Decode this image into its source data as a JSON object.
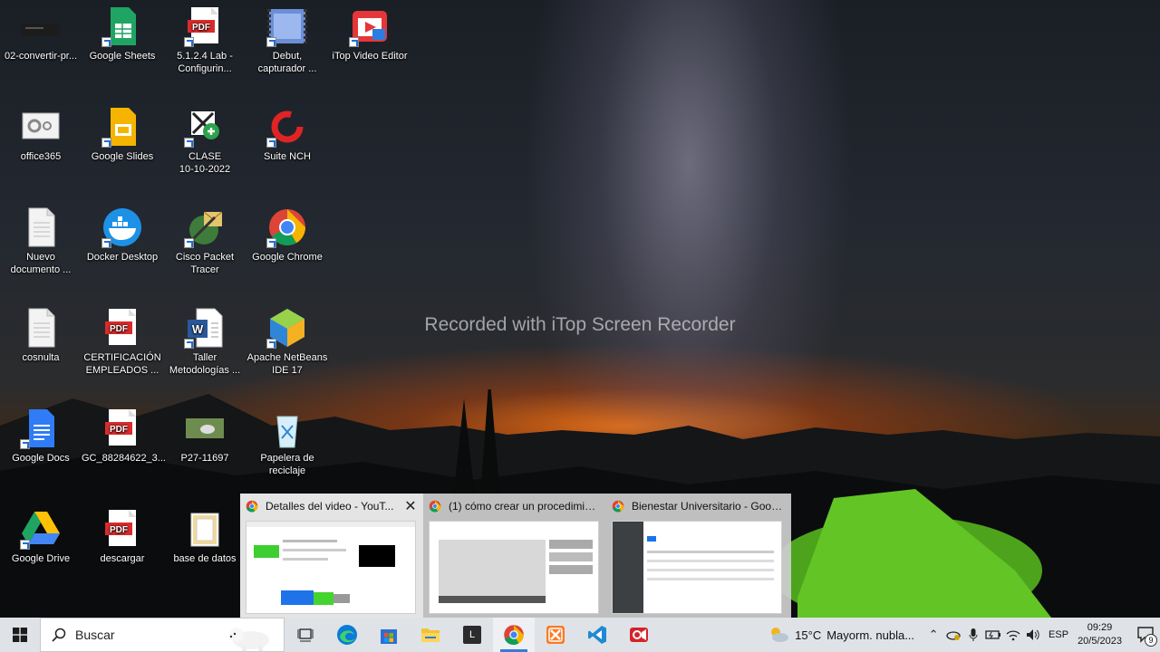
{
  "desktop": {
    "watermark": "Recorded with iTop Screen Recorder",
    "icons": [
      {
        "label": "02-convertir-pr...",
        "icon": "file-thumbnail-icon"
      },
      {
        "label": "Google Sheets",
        "icon": "google-sheets-icon"
      },
      {
        "label": "5.1.2.4 Lab -\nConfigurin...",
        "icon": "pdf-icon"
      },
      {
        "label": "Debut,\ncapturador ...",
        "icon": "debut-video-capture-icon"
      },
      {
        "label": "iTop Video Editor",
        "icon": "itop-video-editor-icon"
      },
      {
        "label": "office365",
        "icon": "office365-icon"
      },
      {
        "label": "Google Slides",
        "icon": "google-slides-icon"
      },
      {
        "label": "CLASE\n10-10-2022",
        "icon": "clase-video-icon"
      },
      {
        "label": "Suite NCH",
        "icon": "suite-nch-icon"
      },
      {
        "label": "Nuevo\ndocumento ...",
        "icon": "text-document-icon"
      },
      {
        "label": "Docker Desktop",
        "icon": "docker-icon"
      },
      {
        "label": "Cisco Packet\nTracer",
        "icon": "cisco-packet-tracer-icon"
      },
      {
        "label": "Google Chrome",
        "icon": "chrome-icon"
      },
      {
        "label": "cosnulta",
        "icon": "text-document-icon"
      },
      {
        "label": "CERTIFICACIÓN\nEMPLEADOS ...",
        "icon": "pdf-icon"
      },
      {
        "label": "Taller\nMetodologías ...",
        "icon": "word-icon"
      },
      {
        "label": "Apache NetBeans\nIDE 17",
        "icon": "netbeans-icon"
      },
      {
        "label": "Google Docs",
        "icon": "google-docs-icon"
      },
      {
        "label": "GC_88284622_3...",
        "icon": "pdf-icon"
      },
      {
        "label": "P27-11697",
        "icon": "image-file-icon"
      },
      {
        "label": "Papelera de\nreciclaje",
        "icon": "recycle-bin-icon"
      },
      {
        "label": "Google Drive",
        "icon": "google-drive-icon"
      },
      {
        "label": "descargar",
        "icon": "pdf-icon"
      },
      {
        "label": "base de datos",
        "icon": "folder-icon"
      }
    ]
  },
  "task_previews": [
    {
      "title": "Detalles del video - YouT...",
      "close": "✕"
    },
    {
      "title": "(1) cómo crear un procedimien..."
    },
    {
      "title": "Bienestar Universitario - Google..."
    }
  ],
  "taskbar": {
    "search_placeholder": "Buscar",
    "apps": [
      "task-view-icon",
      "edge-icon",
      "store-icon",
      "file-explorer-icon",
      "l-app-icon",
      "chrome-icon",
      "xampp-icon",
      "vscode-icon",
      "itop-recorder-icon"
    ],
    "weather": {
      "temp": "15°C",
      "desc": "Mayorm. nubla..."
    },
    "language": "ESP",
    "time": "09:29",
    "date": "20/5/2023",
    "notification_count": "9"
  },
  "colors": {
    "taskbar_bg": "#dfe3e8",
    "accent": "#3a79d6"
  }
}
